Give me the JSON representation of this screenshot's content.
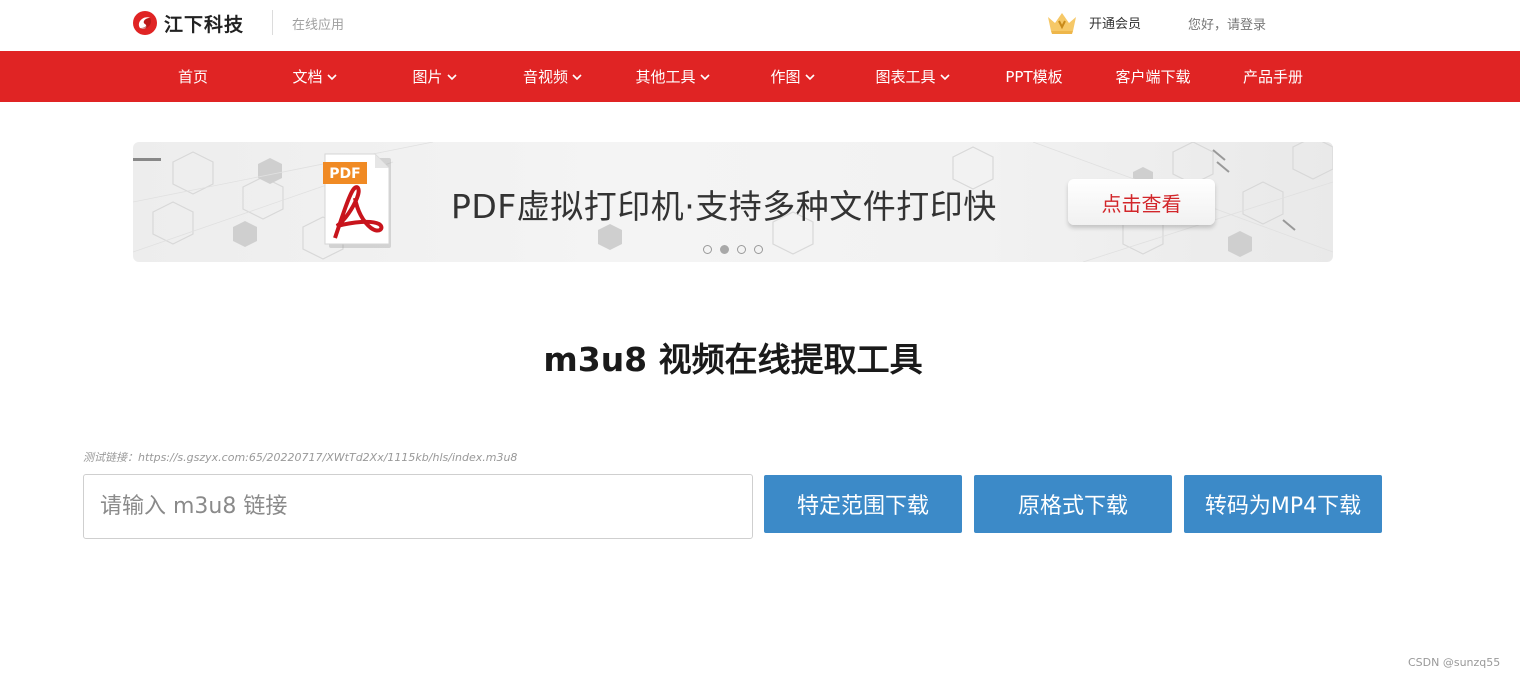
{
  "header": {
    "logo_text": "江下科技",
    "subtitle": "在线应用",
    "vip_label": "开通会员",
    "login_label": "您好，请登录"
  },
  "nav": {
    "items": [
      {
        "label": "首页",
        "has_dropdown": false
      },
      {
        "label": "文档",
        "has_dropdown": true
      },
      {
        "label": "图片",
        "has_dropdown": true
      },
      {
        "label": "音视频",
        "has_dropdown": true
      },
      {
        "label": "其他工具",
        "has_dropdown": true
      },
      {
        "label": "作图",
        "has_dropdown": true
      },
      {
        "label": "图表工具",
        "has_dropdown": true
      },
      {
        "label": "PPT模板",
        "has_dropdown": false
      },
      {
        "label": "客户端下载",
        "has_dropdown": false
      },
      {
        "label": "产品手册",
        "has_dropdown": false
      }
    ]
  },
  "banner": {
    "pdf_badge": "PDF",
    "text": "PDF虚拟打印机·支持多种文件打印快",
    "button_label": "点击查看",
    "slide_count": 4,
    "active_slide": 2
  },
  "main": {
    "title": "m3u8 视频在线提取工具",
    "test_link": "测试链接：https://s.gszyx.com:65/20220717/XWtTd2Xx/1115kb/hls/index.m3u8",
    "input_placeholder": "请输入 m3u8 链接",
    "input_value": "",
    "buttons": {
      "range_download": "特定范围下载",
      "original_download": "原格式下载",
      "mp4_download": "转码为MP4下载"
    }
  },
  "watermark": "CSDN @sunzq55",
  "colors": {
    "nav_bg": "#e02424",
    "button_bg": "#3c8ac8",
    "banner_button_text": "#d2262a"
  },
  "icons": {
    "logo": "jiangxia-logo-icon",
    "vip": "crown-icon",
    "dropdown": "chevron-down-icon",
    "pdf": "pdf-file-icon"
  }
}
